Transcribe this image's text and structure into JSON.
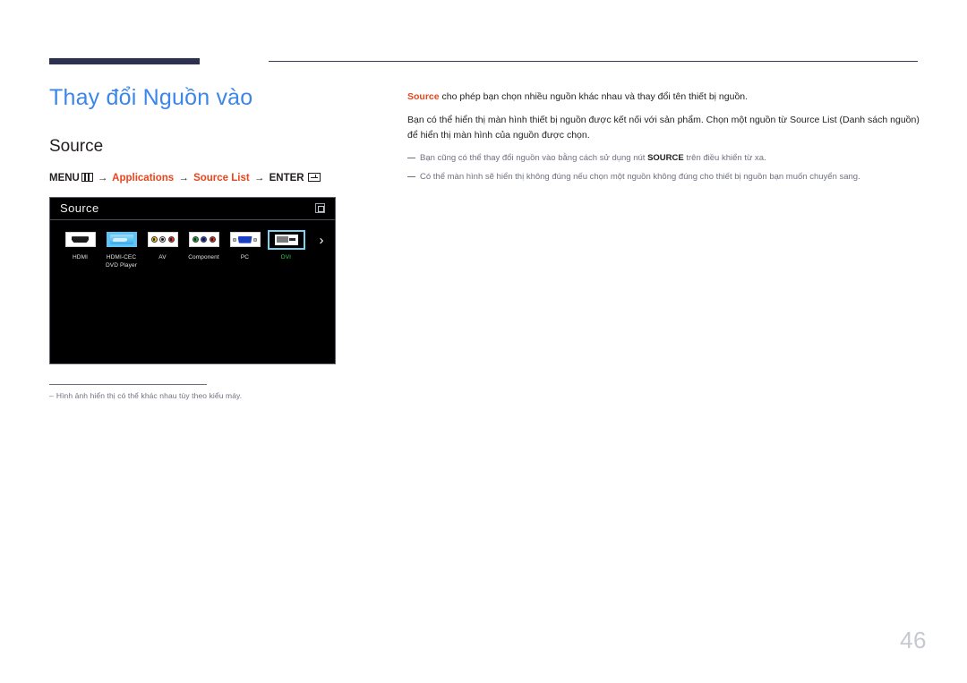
{
  "header": {
    "title": "Thay đổi Nguồn vào",
    "subheading": "Source"
  },
  "menu_path": {
    "menu_label": "MENU",
    "menu_icon": "menu-grid-icon",
    "arrow": "→",
    "step1": "Applications",
    "step2": "Source List",
    "enter_label": "ENTER",
    "enter_icon": "enter-return-icon"
  },
  "osd": {
    "title": "Source",
    "corner_icon": "pip-window-icon",
    "next_arrow": "›",
    "selected_color": "#7fd2ef",
    "selected_label_color": "#35d04a",
    "sources": [
      {
        "label": "HDMI",
        "icon": "hdmi-port-icon",
        "selected": false
      },
      {
        "label": "HDMI-CEC\nDVD Player",
        "icon": "hdmi-cec-dvd-icon",
        "selected": false
      },
      {
        "label": "AV",
        "icon": "av-rca-icon",
        "selected": false
      },
      {
        "label": "Component",
        "icon": "component-rca-icon",
        "selected": false
      },
      {
        "label": "PC",
        "icon": "vga-port-icon",
        "selected": false
      },
      {
        "label": "DVI",
        "icon": "dvi-port-icon",
        "selected": true
      }
    ]
  },
  "footnote": {
    "dash": "‒",
    "text": "Hình ảnh hiển thị có thể khác nhau tùy theo kiểu máy."
  },
  "body": {
    "lead_term": "Source",
    "lead_rest": " cho phép bạn chọn nhiều nguồn khác nhau và thay đổi tên thiết bị nguồn.",
    "paragraph": "Bạn có thể hiển thị màn hình thiết bị nguồn được kết nối với sản phẩm. Chọn một nguồn từ Source List (Danh sách nguồn) để hiển thị màn hình của nguồn được chọn.",
    "note1_pre": "Bạn cũng có thể thay đổi nguồn vào bằng cách sử dụng nút ",
    "note1_bold": "SOURCE",
    "note1_post": " trên điều khiển từ xa.",
    "note2": "Có thể màn hình sẽ hiển thị không đúng nếu chọn một nguồn không đúng cho thiết bị nguồn bạn muốn chuyển sang."
  },
  "page_number": "46",
  "colors": {
    "title_blue": "#3b86e8",
    "accent_red": "#e8461d",
    "rule_navy": "#2e3050",
    "note_gray": "#6f7180",
    "page_no_gray": "#c7c9d2"
  }
}
